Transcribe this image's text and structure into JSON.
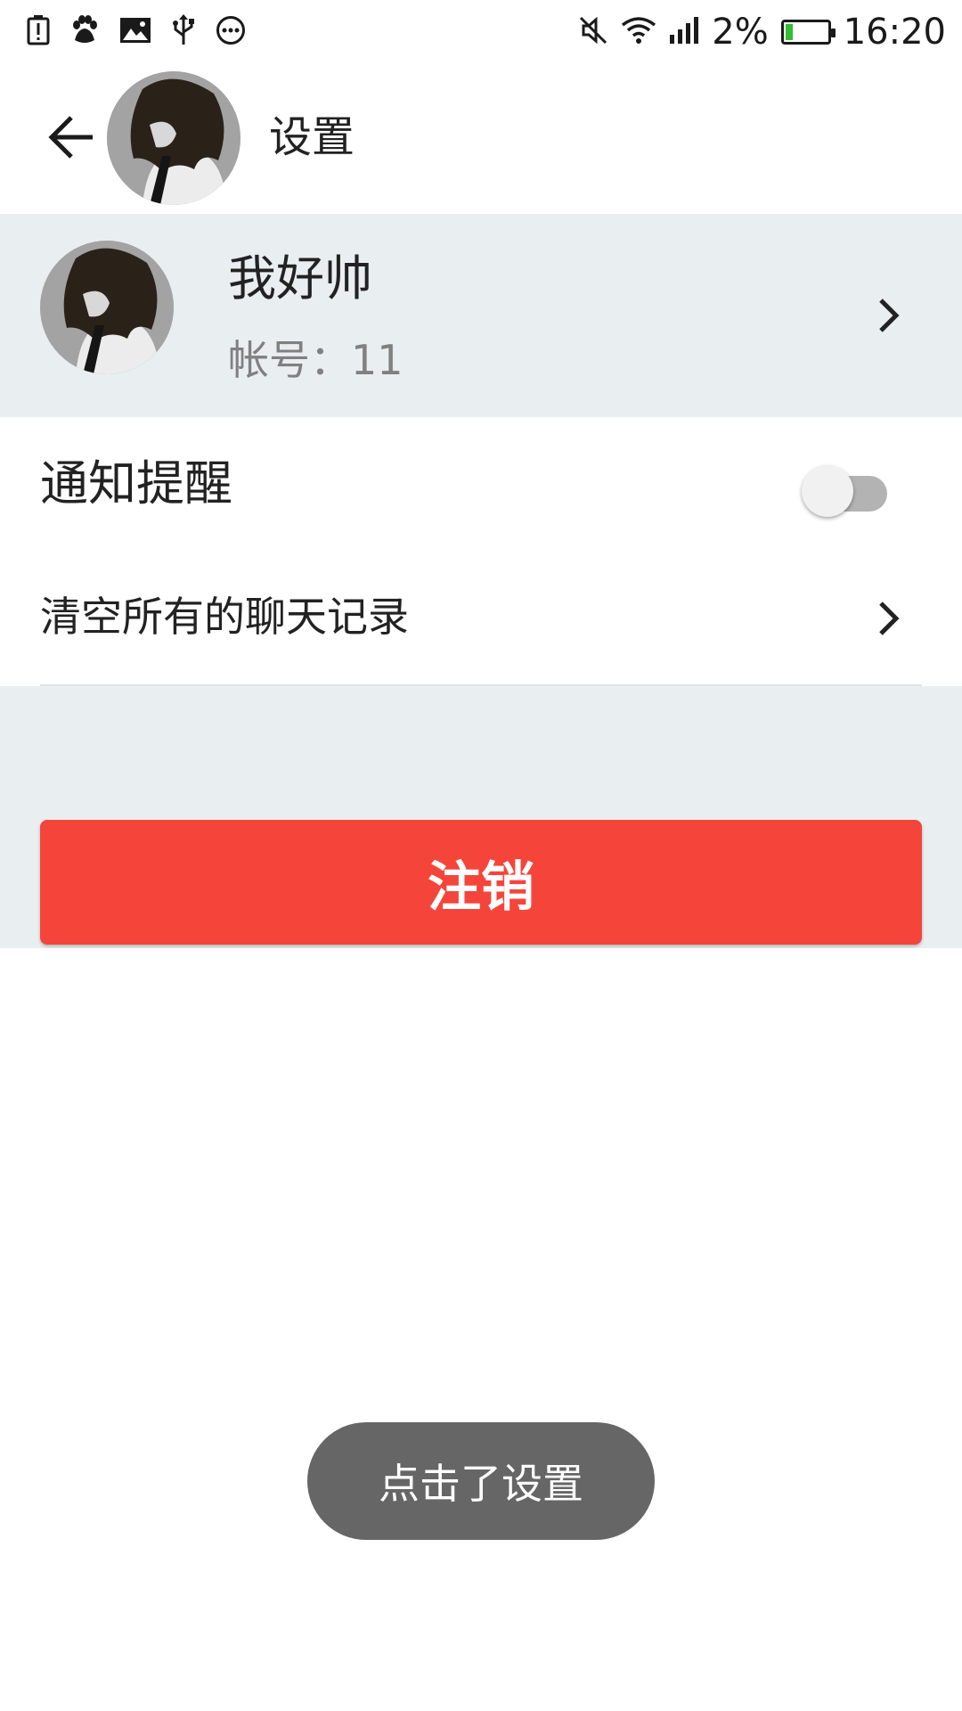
{
  "status_bar": {
    "icons_left": [
      "battery-alert-icon",
      "baidu-paw-icon",
      "image-icon",
      "usb-icon",
      "more-circle-icon"
    ],
    "icons_right": [
      "mute-icon",
      "wifi-icon",
      "signal-icon",
      "battery-icon"
    ],
    "battery_percent": "2%",
    "time": "16:20"
  },
  "toolbar": {
    "title": "设置",
    "back_icon": "arrow-left-icon"
  },
  "profile": {
    "name": "我好帅",
    "account": "帐号：11"
  },
  "settings": {
    "notify_label": "通知提醒",
    "notify_enabled": false,
    "clear_label": "清空所有的聊天记录"
  },
  "logout": {
    "label": "注销"
  },
  "toast": {
    "text": "点击了设置"
  },
  "colors": {
    "logout_red": "#f5453b",
    "band_grey": "#e9eef1",
    "toast_grey": "#666666"
  }
}
